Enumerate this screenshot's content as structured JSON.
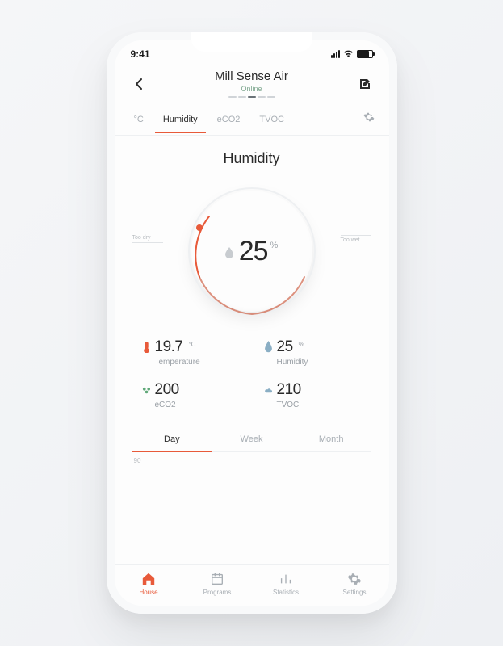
{
  "status_bar": {
    "time": "9:41"
  },
  "header": {
    "title": "Mill Sense Air",
    "status": "Online"
  },
  "tabs": {
    "items": [
      {
        "label": "°C"
      },
      {
        "label": "Humidity"
      },
      {
        "label": "eCO2"
      },
      {
        "label": "TVOC"
      }
    ],
    "active_index": 1
  },
  "main": {
    "title": "Humidity",
    "gauge": {
      "value": "25",
      "unit": "%",
      "label_low": "Too dry",
      "label_high": "Too wet"
    }
  },
  "metrics": [
    {
      "value": "19.7",
      "unit": "°C",
      "label": "Temperature",
      "icon": "thermometer",
      "color": "#e85a3a"
    },
    {
      "value": "25",
      "unit": "%",
      "label": "Humidity",
      "icon": "drop",
      "color": "#8aaec4"
    },
    {
      "value": "200",
      "unit": "",
      "label": "eCO2",
      "icon": "co2",
      "color": "#5fa878"
    },
    {
      "value": "210",
      "unit": "",
      "label": "TVOC",
      "icon": "cloud",
      "color": "#8aaec4"
    }
  ],
  "period_tabs": {
    "items": [
      "Day",
      "Week",
      "Month"
    ],
    "active_index": 0
  },
  "chart": {
    "y_hint": "90"
  },
  "bottom_nav": {
    "items": [
      {
        "label": "House",
        "icon": "home"
      },
      {
        "label": "Programs",
        "icon": "calendar"
      },
      {
        "label": "Statistics",
        "icon": "chart"
      },
      {
        "label": "Settings",
        "icon": "gear"
      }
    ],
    "active_index": 0
  },
  "colors": {
    "accent": "#e85a3a",
    "muted": "#a8aeb4"
  }
}
